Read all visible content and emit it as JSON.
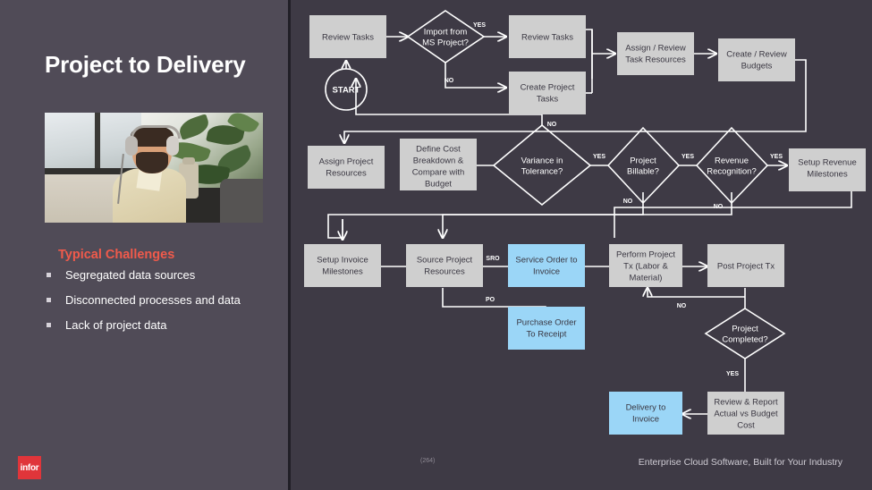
{
  "slide": {
    "title": "Project to Delivery",
    "challenges_heading": "Typical Challenges",
    "bullets": [
      "Segregated data sources",
      "Disconnected processes and data",
      "Lack of project data"
    ],
    "logo_text": "infor",
    "page_number": "(264)",
    "tagline": "Enterprise Cloud Software, Built for Your Industry",
    "photo_alt": "man-with-headset-at-desk-photo",
    "colors": {
      "left_panel": "#504b57",
      "right_panel": "#3e3a45",
      "accent_red": "#f05a4b",
      "logo_red": "#e0353a",
      "node_grey": "#cfcfcf",
      "node_blue": "#9bd6f7",
      "connector": "#ffffff"
    }
  },
  "flowchart": {
    "start": {
      "label": "START"
    },
    "nodes": [
      {
        "id": "review_tasks_1",
        "label": "Review Tasks",
        "type": "process",
        "fill": "grey"
      },
      {
        "id": "review_tasks_2",
        "label": "Review Tasks",
        "type": "process",
        "fill": "grey"
      },
      {
        "id": "create_tasks",
        "label": "Create Project Tasks",
        "type": "process",
        "fill": "grey"
      },
      {
        "id": "assign_task_res",
        "label": "Assign / Review Task Resources",
        "type": "process",
        "fill": "grey"
      },
      {
        "id": "create_budgets",
        "label": "Create / Review Budgets",
        "type": "process",
        "fill": "grey"
      },
      {
        "id": "assign_proj_res",
        "label": "Assign Project Resources",
        "type": "process",
        "fill": "grey"
      },
      {
        "id": "define_cost",
        "label": "Define Cost Breakdown & Compare with Budget",
        "type": "process",
        "fill": "grey"
      },
      {
        "id": "setup_rev_ms",
        "label": "Setup Revenue Milestones",
        "type": "process",
        "fill": "grey"
      },
      {
        "id": "setup_inv_ms",
        "label": "Setup Invoice Milestones",
        "type": "process",
        "fill": "grey"
      },
      {
        "id": "source_proj_res",
        "label": "Source Project Resources",
        "type": "process",
        "fill": "grey"
      },
      {
        "id": "service_order",
        "label": "Service Order to Invoice",
        "type": "process",
        "fill": "blue"
      },
      {
        "id": "purchase_order",
        "label": "Purchase Order To Receipt",
        "type": "process",
        "fill": "blue"
      },
      {
        "id": "perform_tx",
        "label": "Perform Project Tx (Labor & Material)",
        "type": "process",
        "fill": "grey"
      },
      {
        "id": "post_tx",
        "label": "Post Project Tx",
        "type": "process",
        "fill": "grey"
      },
      {
        "id": "review_report",
        "label": "Review & Report Actual vs Budget Cost",
        "type": "process",
        "fill": "grey"
      },
      {
        "id": "delivery_invoice",
        "label": "Delivery to Invoice",
        "type": "process",
        "fill": "blue"
      }
    ],
    "decisions": [
      {
        "id": "import_ms",
        "label": "Import from MS Project?"
      },
      {
        "id": "variance",
        "label": "Variance in Tolerance?"
      },
      {
        "id": "billable",
        "label": "Project Billable?"
      },
      {
        "id": "rev_recog",
        "label": "Revenue Recognition?"
      },
      {
        "id": "completed",
        "label": "Project Completed?"
      }
    ],
    "edge_labels": {
      "import_yes": "YES",
      "import_no": "NO",
      "budget_no": "NO",
      "variance_yes": "YES",
      "billable_yes": "YES",
      "billable_no": "NO",
      "rev_yes": "YES",
      "rev_no": "NO",
      "sro": "SRO",
      "po": "PO",
      "post_no": "NO",
      "completed_yes": "YES"
    }
  }
}
